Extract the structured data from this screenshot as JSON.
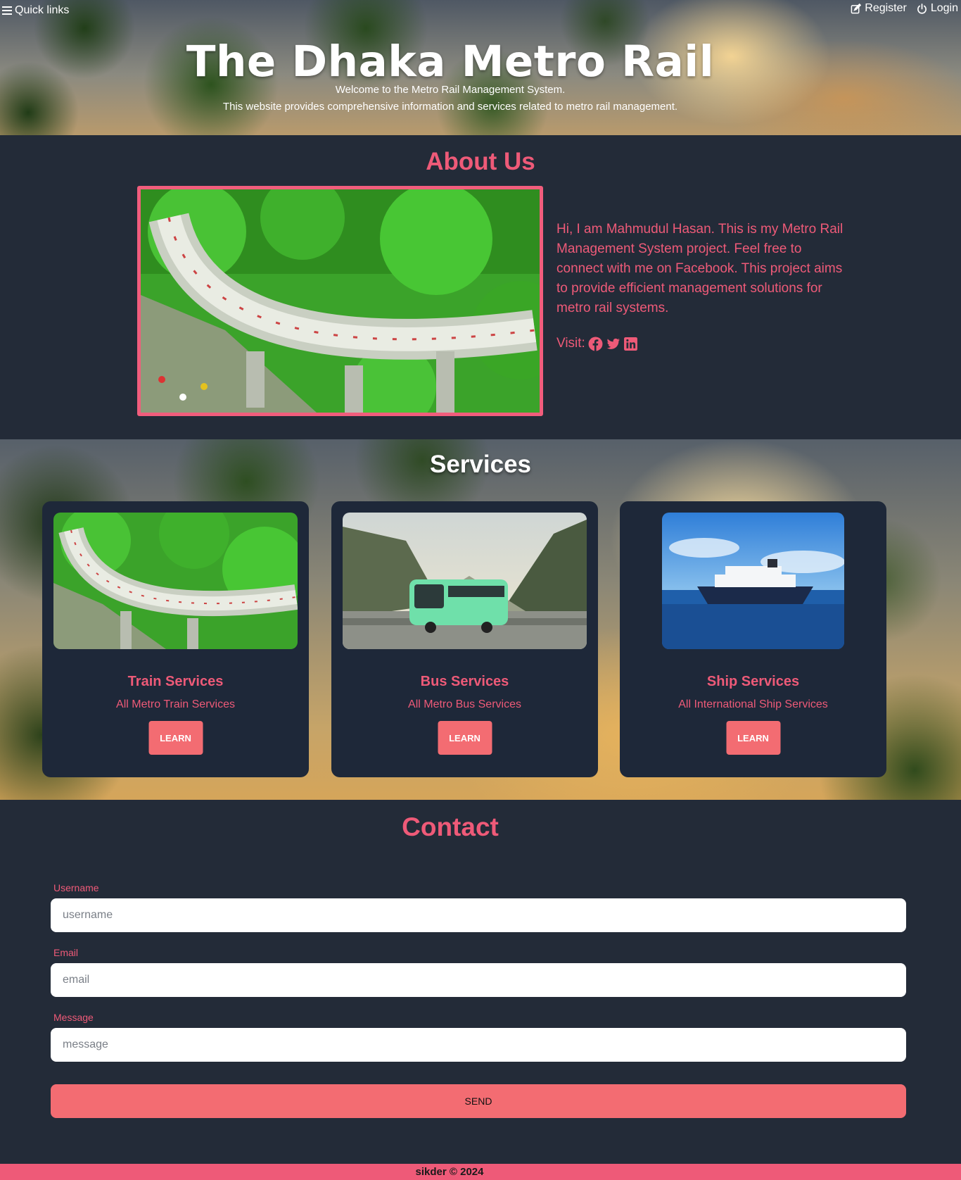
{
  "header": {
    "quick_links_label": "Quick links",
    "register_label": "Register",
    "login_label": "Login",
    "title": "The Dhaka Metro Rail",
    "subtitle_line1": "Welcome to the Metro Rail Management System.",
    "subtitle_line2": "This website provides comprehensive information and services related to metro rail management."
  },
  "about": {
    "heading": "About Us",
    "text": "Hi, I am Mahmudul Hasan. This is my Metro Rail Management System project. Feel free to connect with me on Facebook. This project aims to provide efficient management solutions for metro rail systems.",
    "visit_label": "Visit:",
    "social_icons": [
      "facebook-icon",
      "twitter-icon",
      "linkedin-icon"
    ]
  },
  "services": {
    "heading": "Services",
    "cards": [
      {
        "title": "Train Services",
        "description": "All Metro Train Services",
        "button_label": "LEARN"
      },
      {
        "title": "Bus Services",
        "description": "All Metro Bus Services",
        "button_label": "LEARN"
      },
      {
        "title": "Ship Services",
        "description": "All International Ship Services",
        "button_label": "LEARN"
      }
    ]
  },
  "contact": {
    "heading": "Contact",
    "username_label": "Username",
    "username_placeholder": "username",
    "email_label": "Email",
    "email_placeholder": "email",
    "message_label": "Message",
    "message_placeholder": "message",
    "send_label": "SEND"
  },
  "footer": {
    "text": "sikder © 2024"
  },
  "colors": {
    "accent_pink": "#ee5a78",
    "button_coral": "#f36c72",
    "background_dark": "#232b38",
    "card_background": "#1e2839"
  }
}
